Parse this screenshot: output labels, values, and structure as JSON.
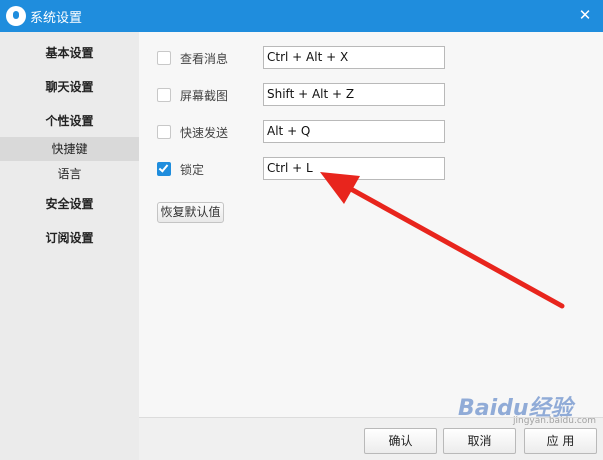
{
  "window": {
    "title": "系统设置",
    "accent_color": "#1f8ddd",
    "close_glyph": "✕"
  },
  "sidebar": {
    "items": [
      {
        "label": "基本设置"
      },
      {
        "label": "聊天设置"
      },
      {
        "label": "个性设置"
      },
      {
        "label": "快捷键",
        "sub": true,
        "active": true
      },
      {
        "label": "语言",
        "sub": true
      },
      {
        "label": "安全设置"
      },
      {
        "label": "订阅设置"
      }
    ]
  },
  "hotkeys": [
    {
      "label": "查看消息",
      "value": "Ctrl + Alt + X",
      "checked": false
    },
    {
      "label": "屏幕截图",
      "value": "Shift + Alt + Z",
      "checked": false
    },
    {
      "label": "快速发送",
      "value": "Alt + Q",
      "checked": false
    },
    {
      "label": "锁定",
      "value": "Ctrl + L",
      "checked": true
    }
  ],
  "restore_button": "恢复默认值",
  "footer": {
    "confirm": "确认",
    "cancel": "取消",
    "apply": "应 用"
  },
  "watermark": {
    "text": "Baidu经验",
    "sub": "jingyan.baidu.com"
  }
}
